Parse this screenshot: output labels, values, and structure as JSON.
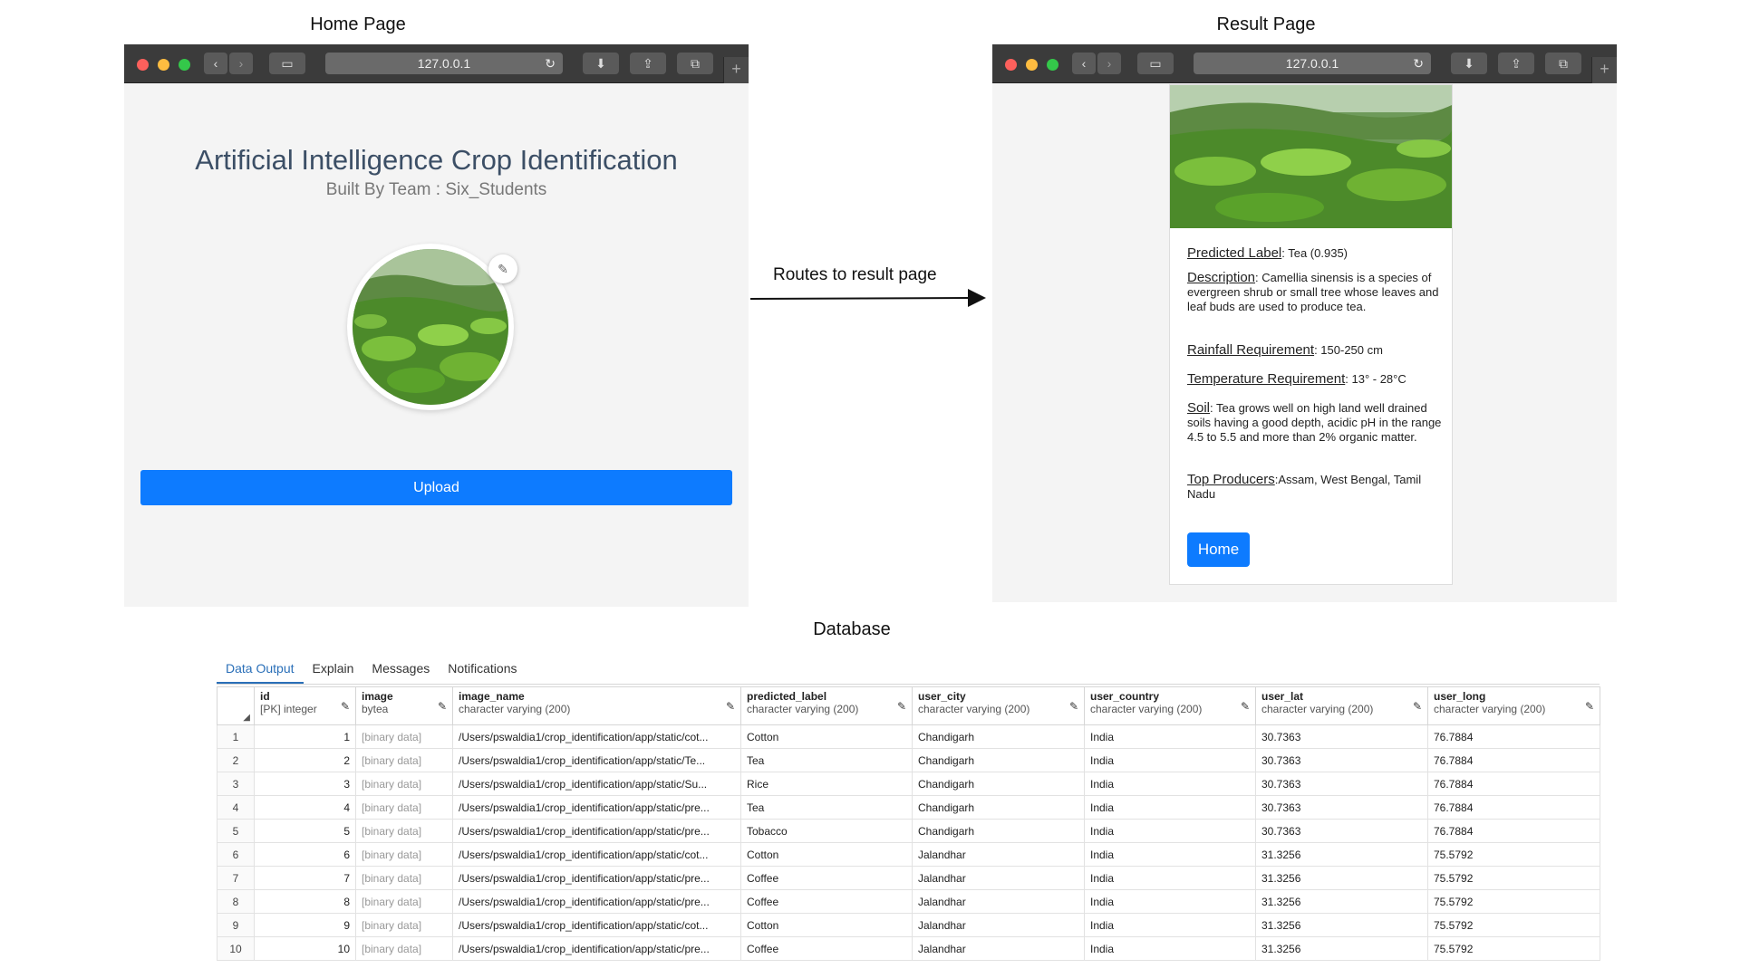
{
  "labels": {
    "home_page": "Home Page",
    "result_page": "Result Page",
    "arrow": "Routes to result page",
    "database": "Database"
  },
  "browser": {
    "url": "127.0.0.1"
  },
  "home": {
    "title": "Artificial Intelligence Crop Identification",
    "subtitle": "Built By Team : Six_Students",
    "upload_label": "Upload"
  },
  "result": {
    "predicted_label_key": "Predicted Label",
    "predicted_label_val": ": Tea (0.935)",
    "description_key": "Description",
    "description_val": ": Camellia sinensis is a species of evergreen shrub or small tree whose leaves and leaf buds are used to produce tea.",
    "rainfall_key": "Rainfall Requirement",
    "rainfall_val": ": 150-250 cm",
    "temperature_key": "Temperature Requirement",
    "temperature_val": ": 13° - 28°C",
    "soil_key": "Soil",
    "soil_val": ": Tea grows well on high land well drained soils having a good depth, acidic pH in the range 4.5 to 5.5 and more than 2% organic matter.",
    "producers_key": "Top Producers",
    "producers_val": ":Assam, West Bengal, Tamil Nadu",
    "home_label": "Home"
  },
  "db": {
    "tabs": [
      "Data Output",
      "Explain",
      "Messages",
      "Notifications"
    ],
    "columns": [
      {
        "name": "id",
        "type": "[PK] integer"
      },
      {
        "name": "image",
        "type": "bytea"
      },
      {
        "name": "image_name",
        "type": "character varying (200)"
      },
      {
        "name": "predicted_label",
        "type": "character varying (200)"
      },
      {
        "name": "user_city",
        "type": "character varying (200)"
      },
      {
        "name": "user_country",
        "type": "character varying (200)"
      },
      {
        "name": "user_lat",
        "type": "character varying (200)"
      },
      {
        "name": "user_long",
        "type": "character varying (200)"
      }
    ],
    "rows": [
      [
        "1",
        "1",
        "[binary data]",
        "/Users/pswaldia1/crop_identification/app/static/cot...",
        "Cotton",
        "Chandigarh",
        "India",
        "30.7363",
        "76.7884"
      ],
      [
        "2",
        "2",
        "[binary data]",
        "/Users/pswaldia1/crop_identification/app/static/Te...",
        "Tea",
        "Chandigarh",
        "India",
        "30.7363",
        "76.7884"
      ],
      [
        "3",
        "3",
        "[binary data]",
        "/Users/pswaldia1/crop_identification/app/static/Su...",
        "Rice",
        "Chandigarh",
        "India",
        "30.7363",
        "76.7884"
      ],
      [
        "4",
        "4",
        "[binary data]",
        "/Users/pswaldia1/crop_identification/app/static/pre...",
        "Tea",
        "Chandigarh",
        "India",
        "30.7363",
        "76.7884"
      ],
      [
        "5",
        "5",
        "[binary data]",
        "/Users/pswaldia1/crop_identification/app/static/pre...",
        "Tobacco",
        "Chandigarh",
        "India",
        "30.7363",
        "76.7884"
      ],
      [
        "6",
        "6",
        "[binary data]",
        "/Users/pswaldia1/crop_identification/app/static/cot...",
        "Cotton",
        "Jalandhar",
        "India",
        "31.3256",
        "75.5792"
      ],
      [
        "7",
        "7",
        "[binary data]",
        "/Users/pswaldia1/crop_identification/app/static/pre...",
        "Coffee",
        "Jalandhar",
        "India",
        "31.3256",
        "75.5792"
      ],
      [
        "8",
        "8",
        "[binary data]",
        "/Users/pswaldia1/crop_identification/app/static/pre...",
        "Coffee",
        "Jalandhar",
        "India",
        "31.3256",
        "75.5792"
      ],
      [
        "9",
        "9",
        "[binary data]",
        "/Users/pswaldia1/crop_identification/app/static/cot...",
        "Cotton",
        "Jalandhar",
        "India",
        "31.3256",
        "75.5792"
      ],
      [
        "10",
        "10",
        "[binary data]",
        "/Users/pswaldia1/crop_identification/app/static/pre...",
        "Coffee",
        "Jalandhar",
        "India",
        "31.3256",
        "75.5792"
      ]
    ]
  }
}
